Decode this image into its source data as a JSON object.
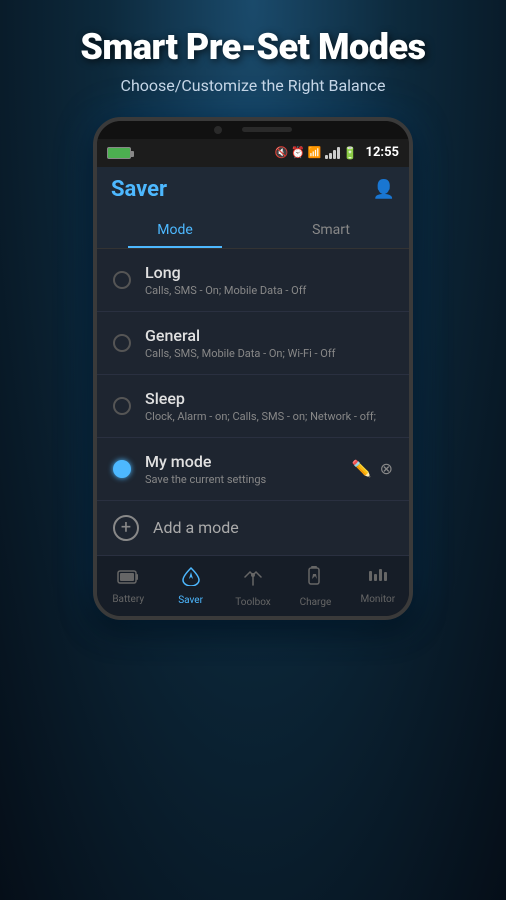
{
  "header": {
    "main_title": "Smart Pre-Set Modes",
    "sub_title": "Choose/Customize the Right Balance"
  },
  "phone": {
    "status_bar": {
      "time": "12:55"
    },
    "app": {
      "title": "Saver",
      "tabs": [
        {
          "label": "Mode",
          "active": true
        },
        {
          "label": "Smart",
          "active": false
        }
      ]
    },
    "modes": [
      {
        "id": "long",
        "name": "Long",
        "desc": "Calls, SMS - On; Mobile Data - Off",
        "active": false
      },
      {
        "id": "general",
        "name": "General",
        "desc": "Calls, SMS, Mobile Data - On; Wi-Fi - Off",
        "active": false
      },
      {
        "id": "sleep",
        "name": "Sleep",
        "desc": "Clock, Alarm - on; Calls, SMS - on; Network - off;",
        "active": false
      },
      {
        "id": "mymode",
        "name": "My mode",
        "desc": "Save the current settings",
        "active": true
      }
    ],
    "add_mode_label": "Add a mode",
    "bottom_nav": [
      {
        "id": "battery",
        "label": "Battery",
        "active": false,
        "icon": "🔋"
      },
      {
        "id": "saver",
        "label": "Saver",
        "active": true,
        "icon": "⚡"
      },
      {
        "id": "toolbox",
        "label": "Toolbox",
        "active": false,
        "icon": "🔧"
      },
      {
        "id": "charge",
        "label": "Charge",
        "active": false,
        "icon": "⚡"
      },
      {
        "id": "monitor",
        "label": "Monitor",
        "active": false,
        "icon": "📊"
      }
    ]
  }
}
